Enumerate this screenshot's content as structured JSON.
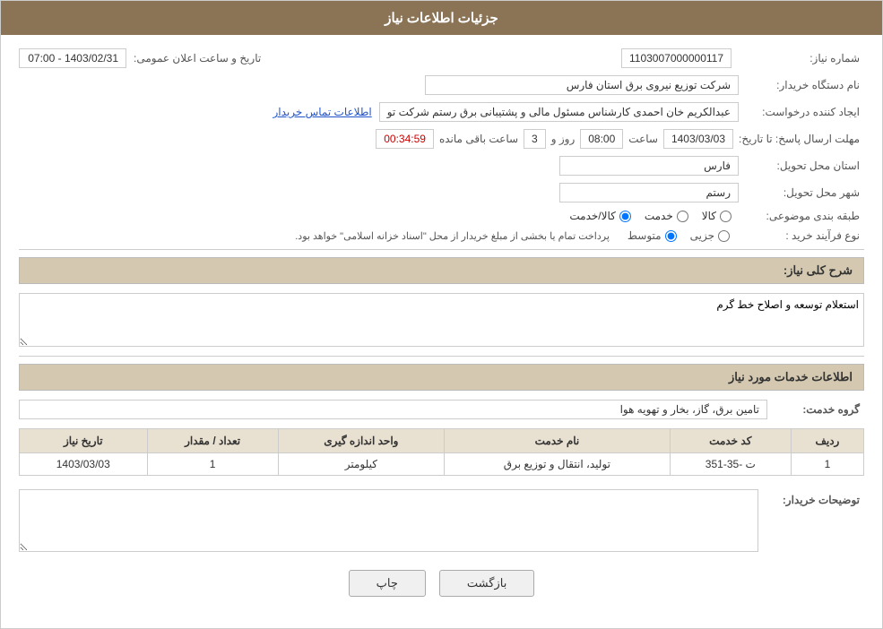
{
  "page": {
    "title": "جزئیات اطلاعات نیاز"
  },
  "header": {
    "shomareNiaz_label": "شماره نیاز:",
    "shomareNiaz_value": "1103007000000117",
    "tarikh_label": "تاریخ و ساعت اعلان عمومی:",
    "tarikh_value": "1403/02/31 - 07:00"
  },
  "fields": {
    "namDastgah_label": "نام دستگاه خریدار:",
    "namDastgah_value": "شرکت توزیع نیروی برق استان فارس",
    "ijad_label": "ایجاد کننده درخواست:",
    "ijad_value": "عبدالکریم خان احمدی کارشناس مسئول مالی و پشتیبانی برق رستم شرکت تو",
    "ijad_link": "اطلاعات تماس خریدار",
    "mohlat_label": "مهلت ارسال پاسخ: تا تاریخ:",
    "mohlat_date": "1403/03/03",
    "mohlat_saat_label": "ساعت",
    "mohlat_saat": "08:00",
    "mohlat_rooz_label": "روز و",
    "mohlat_rooz": "3",
    "mohlat_baqi_label": "ساعت باقی مانده",
    "mohlat_countdown": "00:34:59",
    "ostan_label": "استان محل تحویل:",
    "ostan_value": "فارس",
    "shahr_label": "شهر محل تحویل:",
    "shahr_value": "رستم",
    "tabaqe_label": "طبقه بندی موضوعی:",
    "tabaqe_options": [
      {
        "label": "کالا",
        "value": "kala",
        "checked": false
      },
      {
        "label": "خدمت",
        "value": "khedmat",
        "checked": false
      },
      {
        "label": "کالا/خدمت",
        "value": "kala_khedmat",
        "checked": true
      }
    ],
    "noeFarayand_label": "نوع فرآیند خرید :",
    "noeFarayand_options": [
      {
        "label": "جزیی",
        "value": "jozi",
        "checked": false
      },
      {
        "label": "متوسط",
        "value": "motevaset",
        "checked": true
      }
    ],
    "noeFarayand_note": "پرداخت تمام یا بخشی از مبلغ خریدار از محل \"اسناد خزانه اسلامی\" خواهد بود."
  },
  "sharh": {
    "label": "شرح کلی نیاز:",
    "value": "استعلام توسعه و اصلاح خط گرم"
  },
  "services": {
    "section_label": "اطلاعات خدمات مورد نیاز",
    "group_label": "گروه خدمت:",
    "group_value": "تامین برق، گاز، بخار و تهویه هوا",
    "table": {
      "headers": [
        "ردیف",
        "کد خدمت",
        "نام خدمت",
        "واحد اندازه گیری",
        "تعداد / مقدار",
        "تاریخ نیاز"
      ],
      "rows": [
        {
          "radif": "1",
          "kod": "ت -35-351",
          "nam": "تولید، انتقال و توزیع برق",
          "vahed": "کیلومتر",
          "tedad": "1",
          "tarikh": "1403/03/03"
        }
      ]
    }
  },
  "tozih": {
    "label": "توضیحات خریدار:",
    "value": ""
  },
  "buttons": {
    "back_label": "بازگشت",
    "print_label": "چاپ"
  }
}
